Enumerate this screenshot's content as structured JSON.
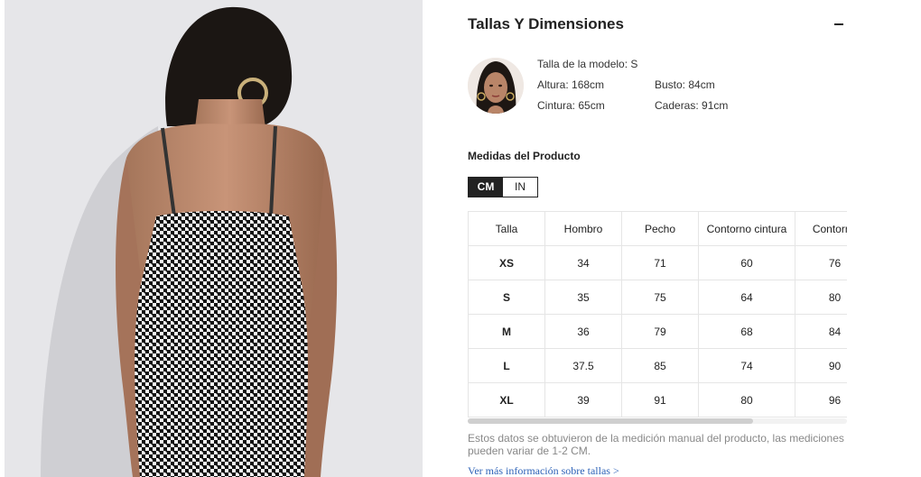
{
  "product_image": {
    "alt": ""
  },
  "size_section": {
    "title": "Tallas Y Dimensiones",
    "collapse_icon": "minus-icon"
  },
  "model": {
    "size": "Talla de la modelo: S",
    "height": "Altura: 168cm",
    "bust": "Busto: 84cm",
    "waist": "Cintura: 65cm",
    "hips": "Caderas: 91cm"
  },
  "measurements": {
    "title": "Medidas del Producto",
    "units": [
      "CM",
      "IN"
    ],
    "selected_unit": "CM",
    "headers": [
      "Talla",
      "Hombro",
      "Pecho",
      "Contorno cintura",
      "Contorno"
    ],
    "rows": [
      [
        "XS",
        "34",
        "71",
        "60",
        "76"
      ],
      [
        "S",
        "35",
        "75",
        "64",
        "80"
      ],
      [
        "M",
        "36",
        "79",
        "68",
        "84"
      ],
      [
        "L",
        "37.5",
        "85",
        "74",
        "90"
      ],
      [
        "XL",
        "39",
        "91",
        "80",
        "96"
      ]
    ],
    "note": "Estos datos se obtuvieron de la medición manual del producto, las mediciones pueden variar de 1-2 CM.",
    "more_link": "Ver más información sobre tallas >"
  }
}
